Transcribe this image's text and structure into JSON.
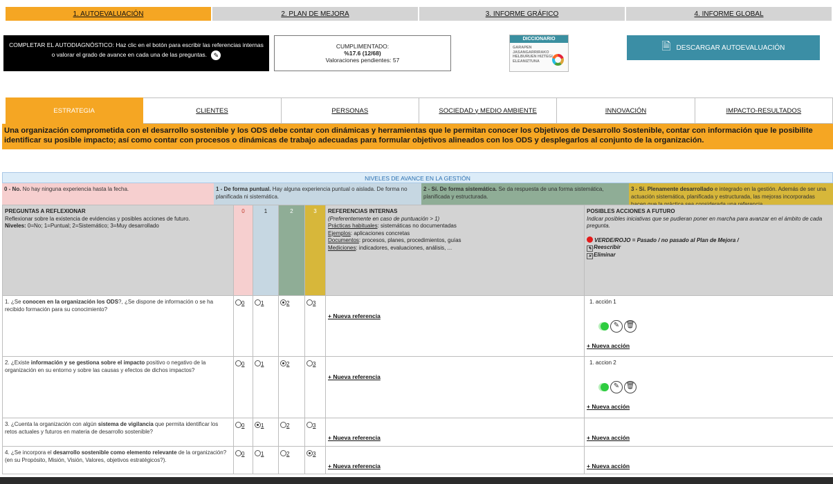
{
  "nav": {
    "tabs": [
      "1. AUTOEVALUACIÓN",
      "2. PLAN DE MEJORA",
      "3. INFORME GRÁFICO",
      "4. INFORME GLOBAL"
    ]
  },
  "header": {
    "instructions": "COMPLETAR EL AUTODIAGNÓSTICO: Haz clic en el botón para escribir las referencias internas o valorar el grado de avance en cada una de las preguntas.",
    "progress_label": "CUMPLIMENTADO:",
    "progress_value": "%17.6 (12/68)",
    "pending": "Valoraciones pendientes: 57",
    "dictionary_title": "DICCIONARIO",
    "dictionary_lines": "GARAPEN JASANGARRIRAKO HELBURUEN HIZTEGI ELEANIZTUNA",
    "download_label": "DESCARGAR AUTOEVALUACIÓN"
  },
  "categories": [
    "ESTRATEGIA",
    "CLIENTES",
    "PERSONAS",
    "SOCIEDAD y MEDIO AMBIENTE",
    "INNOVACIÓN",
    "IMPACTO-RESULTADOS"
  ],
  "description": "Una organización comprometida con el desarrollo sostenible y los ODS debe contar con dinámicas y herramientas que le permitan conocer los Objetivos de Desarrollo Sostenible, contar con información que le posibilite identificar su posible impacto; así como contar con procesos o dinámicas de trabajo adecuadas para formular objetivos alineados con los ODS y desplegarlos al conjunto de la organización.",
  "levels": {
    "title": "NIVELES DE AVANCE EN LA GESTIÓN",
    "items": [
      {
        "bold": "0 - No.",
        "text": " No hay ninguna experiencia hasta la fecha."
      },
      {
        "bold": "1 - De forma puntual.",
        "text": " Hay alguna experiencia puntual o aislada. De forma no planificada ni sistemática."
      },
      {
        "bold": "2 - Sí. De forma sistemática.",
        "text": " Se da respuesta de una forma sistemática, planificada y estructurada."
      },
      {
        "bold": "3 - Sí. Plenamente desarrollado",
        "text": " e integrado en la gestión. Además de ser una actuación sistemática, planificada y estructurada, las mejoras incorporadas hacen que la práctica sea considerada una referencia."
      }
    ]
  },
  "table": {
    "q_title": "PREGUNTAS A REFLEXIONAR",
    "q_sub": "Reflexionar sobre la existencia de evidencias y posibles acciones de futuro.",
    "q_levels_bold": "Niveles:",
    "q_levels_text": " 0=No; 1=Puntual; 2=Sistemático; 3=Muy desarrollado",
    "score_headers": [
      "0",
      "1",
      "2",
      "3"
    ],
    "ref_title": "REFERENCIAS INTERNAS",
    "ref_sub": "(Preferentemente en caso de puntuación > 1)",
    "ref_lines": [
      {
        "u": "Prácticas habituales",
        "t": ": sistemáticas no documentadas"
      },
      {
        "u": "Ejemplos",
        "t": ": aplicaciones concretas"
      },
      {
        "u": "Documentos",
        "t": ": procesos, planes, procedimientos, guías"
      },
      {
        "u": "Mediciones",
        "t": ": indicadores, evaluaciones, análisis, ..."
      }
    ],
    "act_title": "POSIBLES ACCIONES A FUTURO",
    "act_sub": "Indicar posibles iniciativas que se pudieran poner en marcha para avanzar en el ámbito de cada pregunta.",
    "act_legend_1": "VERDE/ROJO = Pasado / no pasado al Plan de Mejora /",
    "act_legend_2": "Reescribir",
    "act_legend_3": "Eliminar",
    "new_ref": "+ Nueva referencia",
    "new_action": "+ Nueva acción",
    "rows": [
      {
        "pre": "1. ¿Se ",
        "bold": "conocen en la organización los ODS",
        "post": "?, ¿Se dispone de información o se ha recibido formación para su conocimiento?",
        "selected": 2,
        "action": "1. acción 1"
      },
      {
        "pre": "2. ¿Existe ",
        "bold": "información y se gestiona sobre el impacto",
        "post": " positivo o negativo de la organización en su entorno y sobre las causas y efectos de dichos impactos?",
        "selected": 2,
        "action": "1. accion 2"
      },
      {
        "pre": "3. ¿Cuenta la organización con algún ",
        "bold": "sistema de vigilancia",
        "post": " que permita identificar los retos actuales y futuros en materia de desarrollo sostenible?",
        "selected": 1,
        "action": ""
      },
      {
        "pre": "4. ¿Se incorpora el ",
        "bold": "desarrollo sostenible como elemento relevante",
        "post": " de la organización? (en su Propósito, Misión, Visión, Valores, objetivos estratégicos?).",
        "selected": 3,
        "action": ""
      }
    ]
  }
}
